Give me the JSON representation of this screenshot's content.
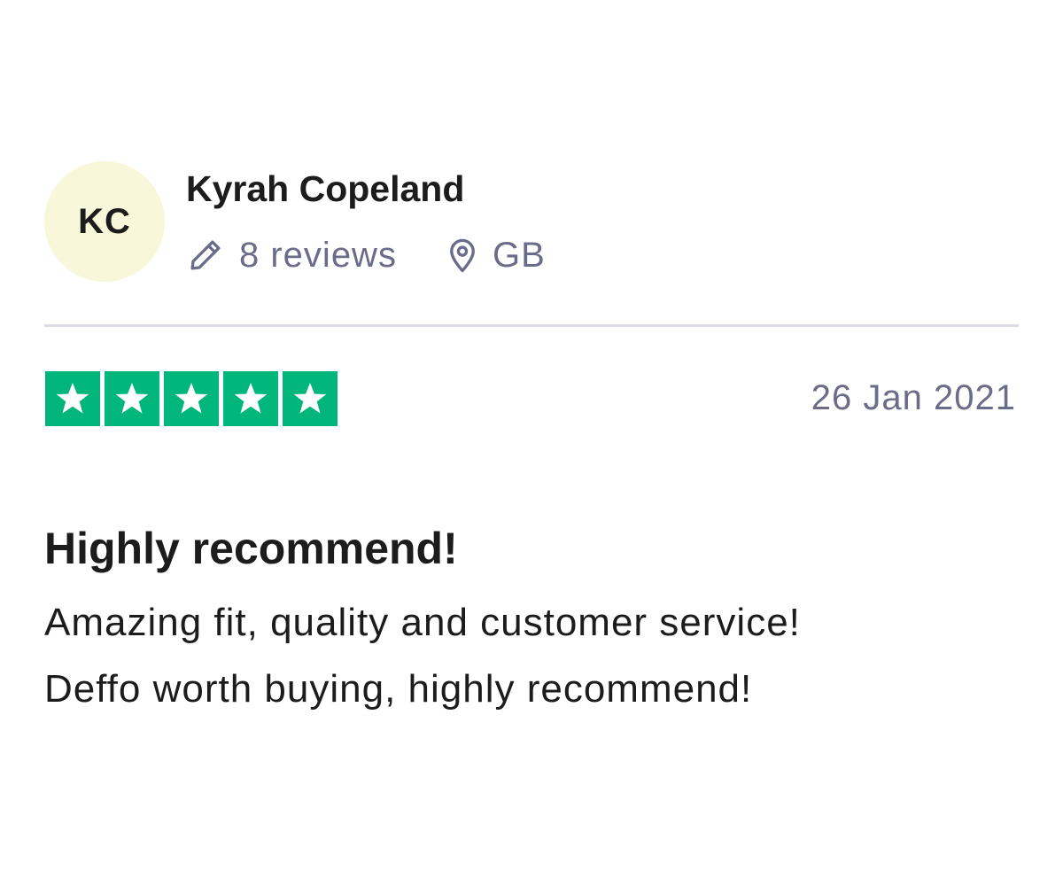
{
  "reviewer": {
    "initials": "KC",
    "name": "Kyrah Copeland",
    "reviews_count": "8 reviews",
    "location": "GB",
    "avatar_color": "#f8f7d9"
  },
  "review": {
    "rating": 5,
    "rating_max": 5,
    "star_color": "#00b67a",
    "date": "26 Jan 2021",
    "title": "Highly recommend!",
    "body_lines": [
      "Amazing fit, quality and customer service!",
      "Deffo worth buying, highly recommend!"
    ]
  },
  "icons": {
    "reviews": "pencil-icon",
    "location": "location-pin-icon",
    "rating": "star-icon"
  }
}
